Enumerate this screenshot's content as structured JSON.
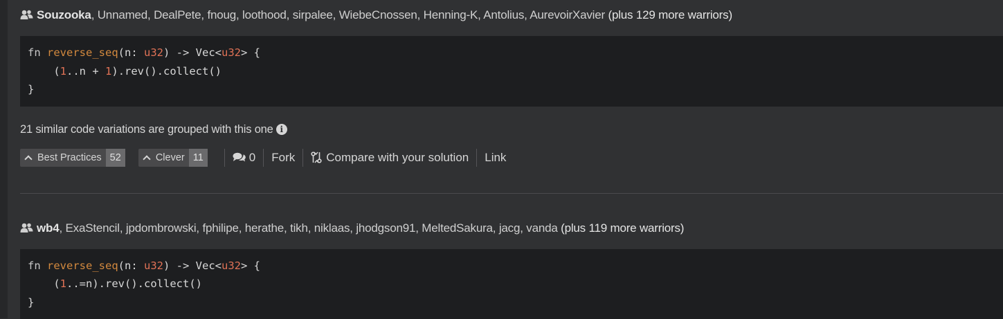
{
  "solutions": [
    {
      "first_warrior": "Souzooka",
      "other_warriors": ", Unnamed, DealPete, fnoug, loothood, sirpalee, WiebeCnossen, Henning-K, Antolius, AurevoirXavier ",
      "more": "(plus 129 more warriors)",
      "code": {
        "line1": {
          "kw": "fn",
          "name": "reverse_seq",
          "p1": "(n: ",
          "t1": "u32",
          "p2": ") -> Vec<",
          "t2": "u32",
          "p3": "> {"
        },
        "line2": {
          "indent": "    (",
          "n1": "1",
          "a": "..n + ",
          "n2": "1",
          "b": ").rev().collect()"
        },
        "line3": "}"
      },
      "grouped_text": "21 similar code variations are grouped with this one",
      "info_icon": "i",
      "best_practices": {
        "label": "Best Practices",
        "count": "52"
      },
      "clever": {
        "label": "Clever",
        "count": "11"
      },
      "comments": "0",
      "fork": "Fork",
      "compare": "Compare with your solution",
      "link": "Link"
    },
    {
      "first_warrior": "wb4",
      "other_warriors": ", ExaStencil, jpdombrowski, fphilipe, herathe, tikh, niklaas, jhodgson91, MeltedSakura, jacg, vanda ",
      "more": "(plus 119 more warriors)",
      "code": {
        "line1": {
          "kw": "fn",
          "name": "reverse_seq",
          "p1": "(n: ",
          "t1": "u32",
          "p2": ") -> Vec<",
          "t2": "u32",
          "p3": "> {"
        },
        "line2": {
          "indent": "    (",
          "n1": "1",
          "a": "..=n).rev().collect()"
        },
        "line3": "}"
      }
    }
  ],
  "icons": {
    "group": "users-icon",
    "info": "info-icon",
    "upvote": "chevron-up-icon",
    "comment": "comments-icon",
    "compare": "compare-icon"
  },
  "colors": {
    "background": "#303133",
    "code_bg": "#1d1e20",
    "function_name": "#d3893e",
    "type_number": "#e07256"
  }
}
